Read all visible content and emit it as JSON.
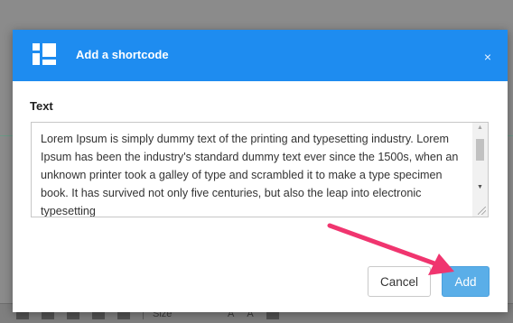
{
  "modal": {
    "title": "Add a shortcode",
    "close_label": "×",
    "field_label": "Text",
    "textarea_value": "Lorem Ipsum is simply dummy text of the printing and typesetting industry. Lorem Ipsum has been the industry's standard dummy text ever since the 1500s, when an unknown printer took a galley of type and scrambled it to make a type specimen book. It has survived not only five centuries, but also the leap into electronic typesetting",
    "cancel_label": "Cancel",
    "add_label": "Add"
  },
  "background_toolbar": {
    "size_label": "Size",
    "font_color_label": "A",
    "bg_color_label": "A"
  },
  "colors": {
    "header": "#1e8cf0",
    "add_button": "#5aaee8",
    "arrow": "#f0356f"
  }
}
